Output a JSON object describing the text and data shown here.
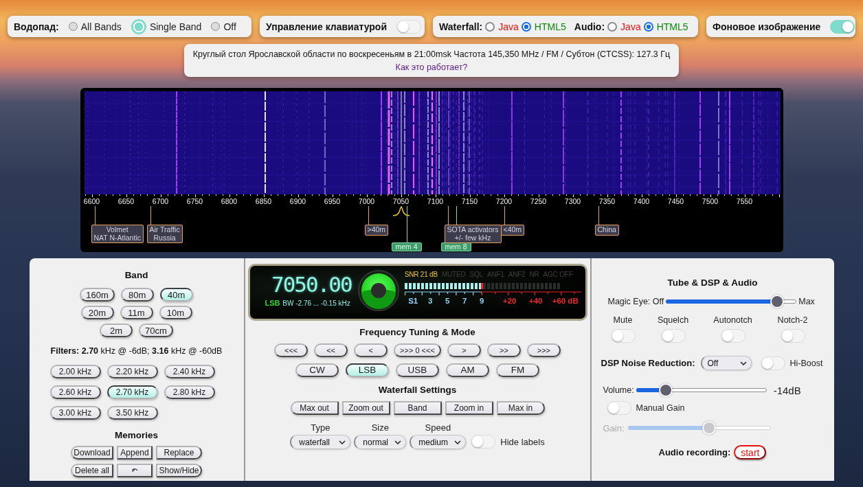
{
  "top_bar": {
    "waterfall_mode": {
      "label": "Водопад:",
      "options": [
        {
          "label": "All Bands",
          "selected": false
        },
        {
          "label": "Single Band",
          "selected": true
        },
        {
          "label": "Off",
          "selected": false
        }
      ]
    },
    "keyboard_control": {
      "label": "Управление клавиатурой",
      "on": false
    },
    "engines": [
      {
        "label": "Waterfall:",
        "options": [
          {
            "label": "Java",
            "selected": false,
            "color": "#ee1111"
          },
          {
            "label": "HTML5",
            "selected": true,
            "color": "#0a8a0a"
          }
        ]
      },
      {
        "label": "Audio:",
        "options": [
          {
            "label": "Java",
            "selected": false,
            "color": "#ee1111"
          },
          {
            "label": "HTML5",
            "selected": true,
            "color": "#0a8a0a"
          }
        ]
      }
    ],
    "background_image": {
      "label": "Фоновое изображение",
      "on": true
    }
  },
  "info": {
    "text": "Круглый стол Ярославской области по воскресеньям в 21:00msk Частота 145,350 MHz / FM / Субтон (CTCSS): 127.3 Гц",
    "link": "Как это работает?"
  },
  "waterfall": {
    "scale": [
      "6600",
      "6650",
      "6700",
      "6750",
      "6800",
      "6850",
      "6900",
      "6950",
      "7000",
      "7050",
      "7100",
      "7150",
      "7200",
      "7250",
      "7300",
      "7350",
      "7400",
      "7450",
      "7500",
      "7550"
    ],
    "markers": [
      {
        "lines": [
          "Volmet",
          "NAT N-Atlantic"
        ]
      },
      {
        "lines": [
          "Air Traffic",
          "Russia"
        ]
      },
      {
        "lines": [
          ">40m"
        ]
      },
      {
        "lines": [
          "SOTA activators",
          "+/- few kHz"
        ]
      },
      {
        "lines": [
          "<40m"
        ]
      },
      {
        "lines": [
          "China"
        ]
      }
    ],
    "memories": [
      {
        "label": "mem 4"
      },
      {
        "label": "mem 8"
      }
    ]
  },
  "band": {
    "title": "Band",
    "buttons": [
      {
        "label": "160m",
        "selected": false
      },
      {
        "label": "80m",
        "selected": false
      },
      {
        "label": "40m",
        "selected": true
      },
      {
        "label": "20m",
        "selected": false
      },
      {
        "label": "11m",
        "selected": false
      },
      {
        "label": "10m",
        "selected": false
      },
      {
        "label": "2m",
        "selected": false
      },
      {
        "label": "70cm",
        "selected": false
      }
    ]
  },
  "filters": {
    "summary": "**Filters:** **2.70** kHz @ -6dB; **3.16** kHz @ -60dB",
    "buttons": [
      {
        "label": "2.00 kHz",
        "selected": false
      },
      {
        "label": "2.20 kHz",
        "selected": false
      },
      {
        "label": "2.40 kHz",
        "selected": false
      },
      {
        "label": "2.60 kHz",
        "selected": false
      },
      {
        "label": "2.70 kHz",
        "selected": true
      },
      {
        "label": "2.80 kHz",
        "selected": false
      },
      {
        "label": "3.00 kHz",
        "selected": false
      },
      {
        "label": "3.50 kHz",
        "selected": false
      }
    ]
  },
  "memories": {
    "title": "Memories",
    "buttons": [
      {
        "kind": "text",
        "label": "Download"
      },
      {
        "kind": "text",
        "label": "Append"
      },
      {
        "kind": "text",
        "label": "Replace"
      },
      {
        "kind": "text",
        "label": "Delete all"
      },
      {
        "kind": "icon"
      },
      {
        "kind": "text",
        "label": "Show/Hide"
      }
    ]
  },
  "display": {
    "frequency": "7050.00",
    "mode": "LSB",
    "bandwidth": "BW -2.76 ... -0.15 kHz",
    "snr": "SNR 21 dB",
    "indicators": [
      {
        "label": "MUTED",
        "on": false
      },
      {
        "label": "SQL",
        "on": false
      },
      {
        "label": "ANF1",
        "on": false
      },
      {
        "label": "ANF2",
        "on": false
      },
      {
        "label": "NR",
        "on": false
      },
      {
        "label": "AGC OFF",
        "on": false
      }
    ],
    "s_meter": {
      "level": 0.5,
      "scale": [
        "S1",
        "3",
        "5",
        "7",
        "9"
      ],
      "over_scale": [
        "+20",
        "+40",
        "+60 dB"
      ]
    }
  },
  "tuning": {
    "title": "Frequency Tuning & Mode",
    "steps": [
      "<<<",
      "<<",
      "<",
      ">>> 0 <<<",
      ">",
      ">>",
      ">>>"
    ],
    "modes": [
      {
        "label": "CW",
        "selected": false
      },
      {
        "label": "LSB",
        "selected": true
      },
      {
        "label": "USB",
        "selected": false
      },
      {
        "label": "AM",
        "selected": false
      },
      {
        "label": "FM",
        "selected": false
      }
    ]
  },
  "waterfall_settings": {
    "title": "Waterfall Settings",
    "zoom": [
      "Max out",
      "Zoom out",
      "Band",
      "Zoom in",
      "Max in"
    ],
    "selects": [
      {
        "label": "Type",
        "value": "waterfall"
      },
      {
        "label": "Size",
        "value": "normal"
      },
      {
        "label": "Speed",
        "value": "medium"
      }
    ],
    "hide_labels": {
      "label": "Hide labels",
      "on": false
    }
  },
  "audio": {
    "title": "Tube & DSP & Audio",
    "magic_eye": {
      "label": "Magic Eye: Off",
      "end_label": "Max",
      "level": 0.85
    },
    "switches": [
      {
        "label": "Mute",
        "on": false
      },
      {
        "label": "Squelch",
        "on": false
      },
      {
        "label": "Autonotch",
        "on": false
      },
      {
        "label": "Notch-2",
        "on": false
      }
    ],
    "noise_reduction": {
      "label": "DSP Noise Reduction:",
      "value": "Off"
    },
    "hi_boost": {
      "label": "Hi-Boost",
      "on": false
    },
    "volume": {
      "label": "Volume:",
      "level": 0.23,
      "reading": "-14dB"
    },
    "manual_gain": {
      "label": "Manual Gain",
      "on": false
    },
    "gain": {
      "label": "Gain:",
      "level": 0.57,
      "disabled": true
    },
    "recording": {
      "label": "Audio recording:",
      "button": "start"
    }
  }
}
